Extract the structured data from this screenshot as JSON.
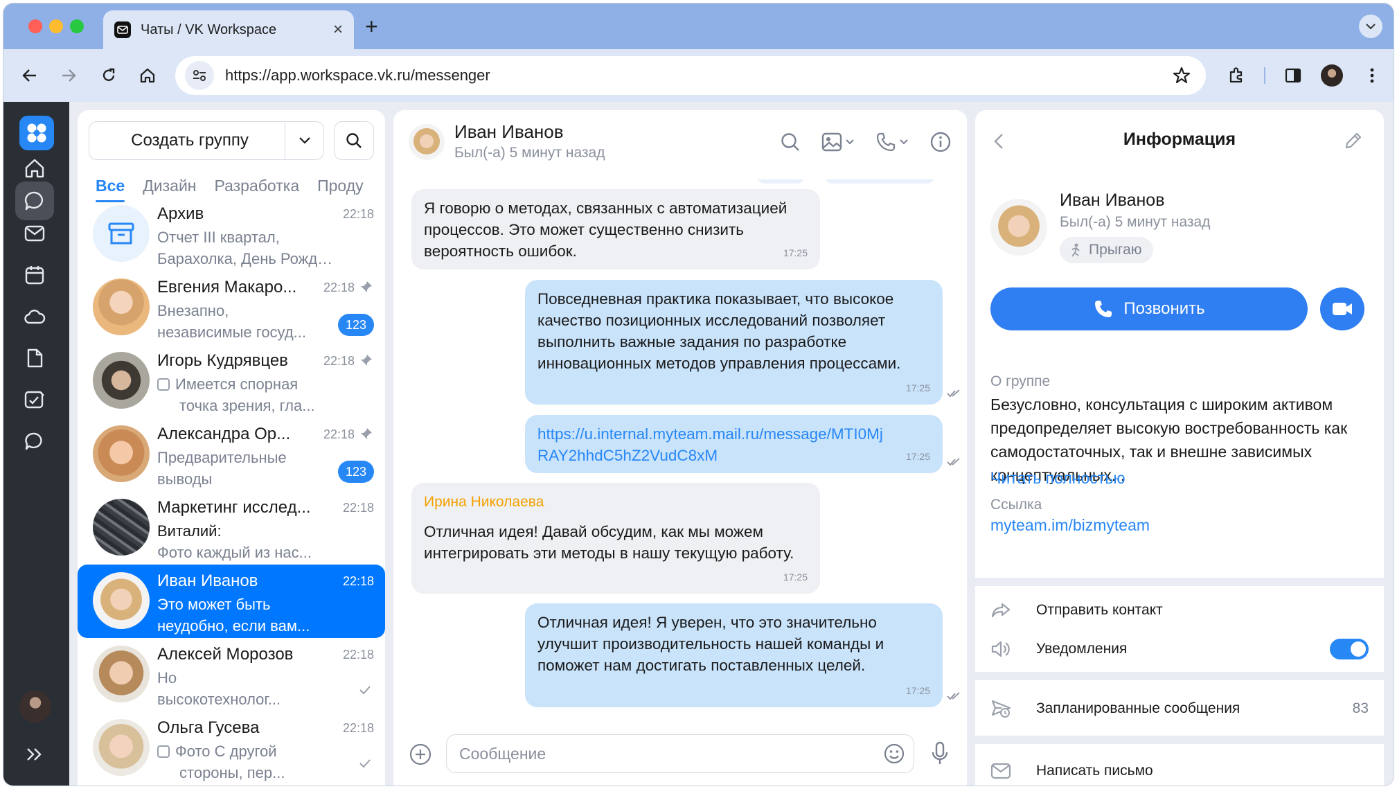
{
  "browser": {
    "tab_title": "Чаты / VK Workspace",
    "new_tab": "+",
    "url": "https://app.workspace.vk.ru/messenger"
  },
  "chat_list": {
    "create_group_label": "Создать группу",
    "folders": [
      "Все",
      "Дизайн",
      "Разработка",
      "Проду"
    ],
    "items": [
      {
        "name": "Архив",
        "time": "22:18",
        "preview": [
          "Отчет III квартал,",
          "Барахолка, День Рожден..."
        ]
      },
      {
        "name": "Евгения Макаро...",
        "time": "22:18",
        "preview": [
          "Внезапно,",
          "независимые госуд..."
        ],
        "badge": "123"
      },
      {
        "name": "Игорь Кудрявцев",
        "time": "22:18",
        "preview": [
          "Имеется спорная",
          "точка зрения, гла..."
        ]
      },
      {
        "name": "Александра Ор...",
        "time": "22:18",
        "preview": [
          "Предварительные",
          "выводы"
        ],
        "badge": "123"
      },
      {
        "name": "Маркетинг исслед...",
        "time": "22:18",
        "preview": [
          "Виталий:",
          "Фото каждый из нас..."
        ]
      },
      {
        "name": "Иван Иванов",
        "time": "22:18",
        "preview": [
          "Это может быть",
          "неудобно, если вам..."
        ]
      },
      {
        "name": "Алексей Морозов",
        "time": "22:18",
        "preview": [
          "Но",
          "высокотехнолог..."
        ]
      },
      {
        "name": "Ольга Гусева",
        "time": "22:18",
        "preview": [
          "Фото С другой",
          "стороны, пер..."
        ]
      }
    ]
  },
  "chat": {
    "name": "Иван Иванов",
    "status": "Был(-а) 5 минут назад",
    "messages": [
      {
        "text": "Я говорю о методах, связанных с автоматизацией процессов. Это может существенно снизить вероятность ошибок.",
        "time": "17:25"
      },
      {
        "text": "Повседневная практика показывает, что высокое качество позиционных исследований позволяет выполнить важные задания по разработке инновационных методов управления процессами.",
        "time": "17:25"
      },
      {
        "text": "https://u.internal.myteam.mail.ru/message/MTI0MjRAY2hhdC5hZ2VudC8xM",
        "time": "17:25"
      },
      {
        "sender": "Ирина Николаева",
        "text": "Отличная идея! Давай обсудим, как мы можем интегрировать эти методы в нашу текущую работу.",
        "time": "17:25"
      },
      {
        "text": "Отличная идея! Я уверен, что это значительно улучшит производительность нашей команды и поможет нам достигать поставленных целей.",
        "time": "17:25"
      }
    ],
    "composer_placeholder": "Сообщение"
  },
  "info": {
    "title": "Информация",
    "name": "Иван Иванов",
    "status": "Был(-а) 5 минут назад",
    "chip": "Прыгаю",
    "call_label": "Позвонить",
    "about_label": "О группе",
    "about_text": "Безусловно, консультация с широким активом предопределяет высокую востребованность как самодостаточных, так и внешне зависимых концептуальных...",
    "read_more": "Читать полностью",
    "link_label": "Ссылка",
    "link": "myteam.im/bizmyteam",
    "send_contact": "Отправить контакт",
    "notifications": "Уведомления",
    "notifications_on": true,
    "scheduled": "Запланированные сообщения",
    "scheduled_count": "83",
    "write_letter": "Написать письмо"
  },
  "colors": {
    "accent": "#2787f5",
    "selected_chat": "#0077ff",
    "outgoing_bubble": "#c9e3fb",
    "incoming_bubble": "#eef0f3",
    "rail": "#2a2e35",
    "sender_name": "#f5a000"
  }
}
